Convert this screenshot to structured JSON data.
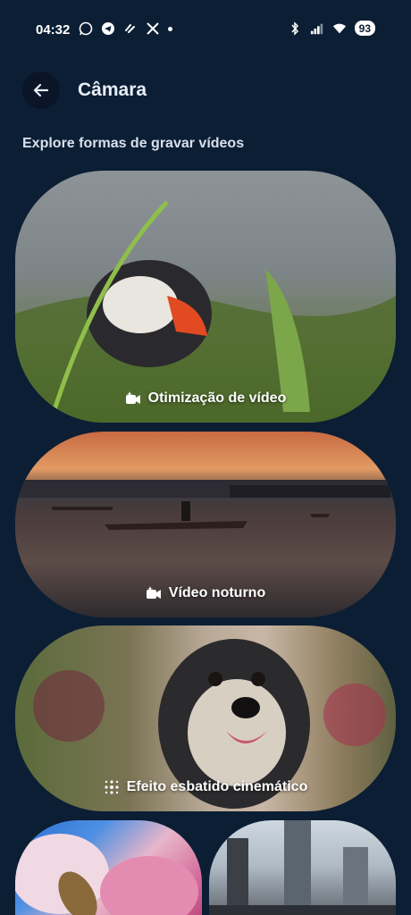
{
  "status_bar": {
    "time": "04:32",
    "battery": "93",
    "left_icons": [
      "whatsapp-icon",
      "telegram-icon",
      "link-icon",
      "x-icon"
    ],
    "right_icons": [
      "bluetooth-icon",
      "signal-icon",
      "wifi-icon",
      "battery-icon"
    ]
  },
  "header": {
    "title": "Câmara"
  },
  "section": {
    "title": "Explore formas de gravar vídeos"
  },
  "cards": [
    {
      "label": "Otimização de vídeo",
      "icon": "video-sparkle-icon"
    },
    {
      "label": "Vídeo noturno",
      "icon": "video-sparkle-icon"
    },
    {
      "label": "Efeito esbatido cinemático",
      "icon": "blur-dots-icon"
    }
  ],
  "colors": {
    "background": "#0b1e34",
    "accent": "#e8eef8"
  }
}
